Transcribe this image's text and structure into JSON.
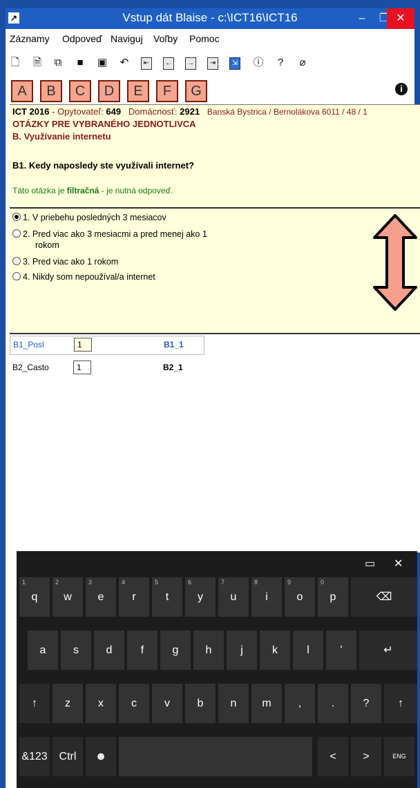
{
  "window": {
    "title": "Vstup dát Blaise - c:\\ICT16\\ICT16",
    "minimize": "–",
    "maximize": "❐",
    "close": "✕"
  },
  "menu": [
    "Záznamy",
    "Odpoveď",
    "Naviguj",
    "Voľby",
    "Pomoc"
  ],
  "toolbar_icons": [
    "new-icon",
    "open-icon",
    "copy-icon",
    "save-icon",
    "print-icon",
    "undo-icon",
    "nav-first-icon",
    "nav-prev-icon",
    "nav-next-icon",
    "nav-last-icon",
    "exit-icon",
    "alert-icon",
    "help-icon",
    "attach-icon"
  ],
  "letters": [
    "A",
    "B",
    "C",
    "D",
    "E",
    "F",
    "G"
  ],
  "header": {
    "survey": "ICT 2016",
    "interviewer_label": "Opytovateľ:",
    "interviewer": "649",
    "household_label": "Domácnosť:",
    "household": "2921",
    "address": "Banská Bystrica / Bernolákova 6011 / 48 / 1",
    "section": "OTÁZKY PRE VYBRANÉHO JEDNOTLIVCA",
    "subsection": "B. Využívanie internetu",
    "question": "B1. Kedy naposledy ste využívali internet?",
    "note_prefix": "Táto otázka je ",
    "note_bold": "filtračná",
    "note_suffix": " - je nutná odpoveď."
  },
  "options": [
    {
      "label": "1. V priebehu posledných 3 mesiacov",
      "selected": true
    },
    {
      "label": "2. Pred viac ako 3 mesiacmi a pred menej ako 1",
      "label2": "rokom",
      "selected": false
    },
    {
      "label": "3. Pred viac ako 1 rokom",
      "selected": false
    },
    {
      "label": "4. Nikdy som nepoužíval/a internet",
      "selected": false
    }
  ],
  "fields": [
    {
      "name": "B1_Posl",
      "value": "1",
      "code": "B1_1",
      "active": true
    },
    {
      "name": "B2_Casto",
      "value": "1",
      "code": "B2_1",
      "active": false
    }
  ],
  "keyboard": {
    "row1": [
      [
        "q",
        "1"
      ],
      [
        "w",
        "2"
      ],
      [
        "e",
        "3"
      ],
      [
        "r",
        "4"
      ],
      [
        "t",
        "5"
      ],
      [
        "y",
        "6"
      ],
      [
        "u",
        "7"
      ],
      [
        "i",
        "8"
      ],
      [
        "o",
        "9"
      ],
      [
        "p",
        "0"
      ]
    ],
    "row2": [
      "a",
      "s",
      "d",
      "f",
      "g",
      "h",
      "j",
      "k",
      "l",
      "'"
    ],
    "row3": [
      "z",
      "x",
      "c",
      "v",
      "b",
      "n",
      "m",
      ",",
      ".",
      "?"
    ],
    "row4_left": [
      "&123",
      "Ctrl",
      "☻"
    ],
    "row4_right": [
      "<",
      ">"
    ],
    "backspace": "⌫",
    "enter": "↵",
    "shift": "↑",
    "lang": "ENG",
    "dock": "▭",
    "close": "✕"
  }
}
